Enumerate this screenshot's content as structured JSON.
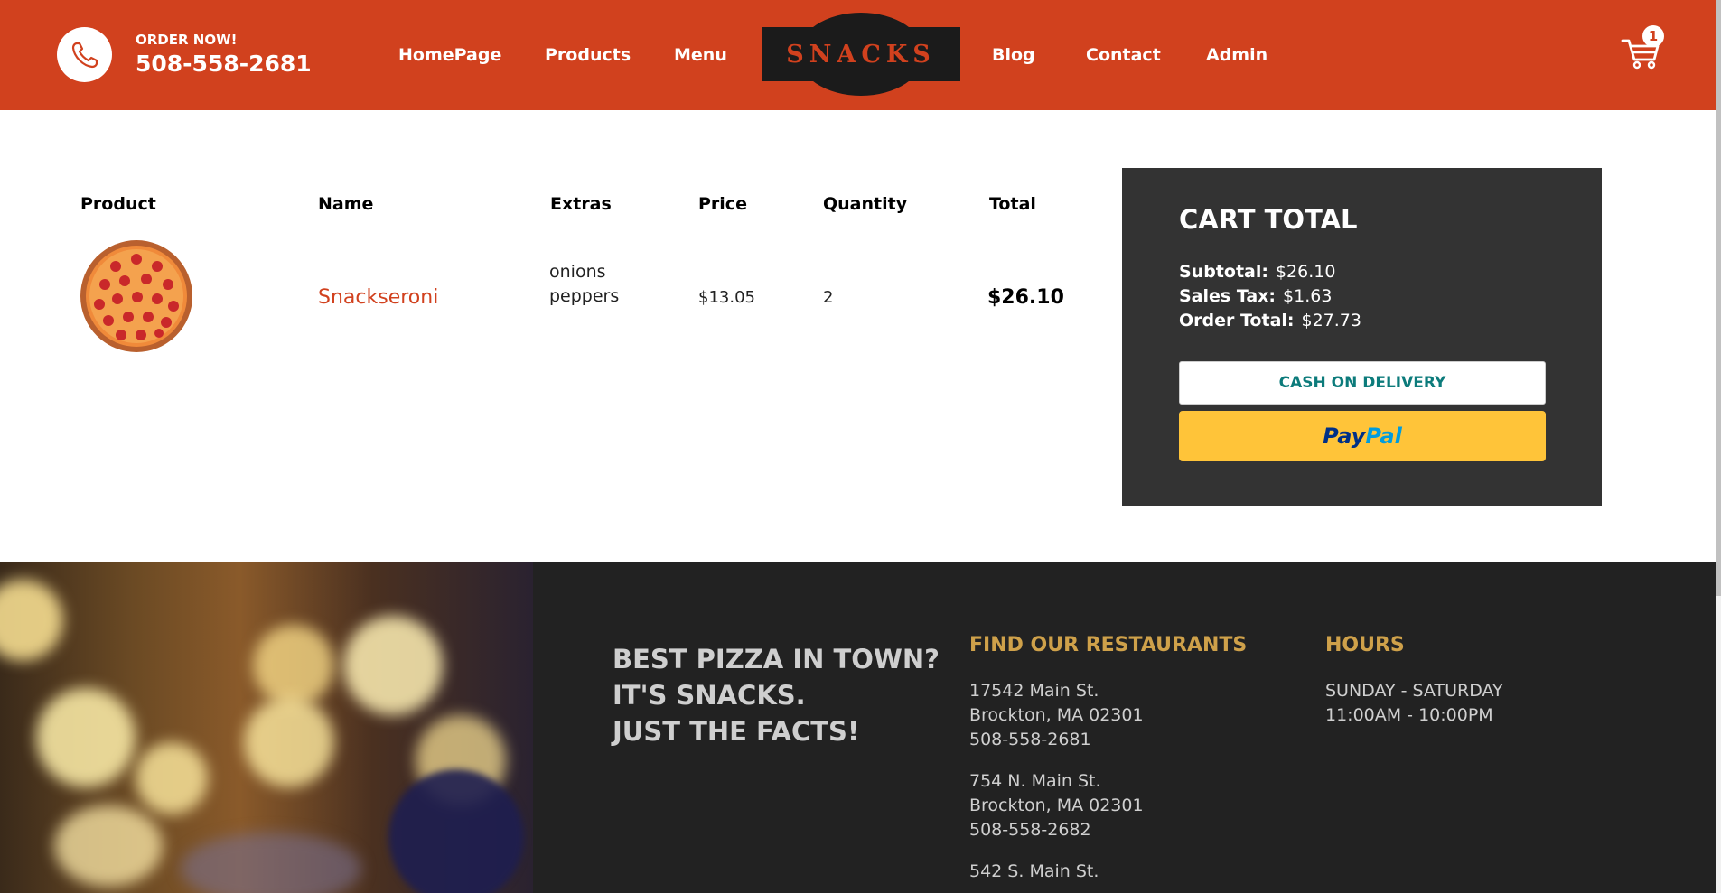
{
  "header": {
    "order_now": "ORDER NOW!",
    "phone": "508-558-2681",
    "nav": [
      "HomePage",
      "Products",
      "Menu",
      "Blog",
      "Contact",
      "Admin"
    ],
    "logo": "SNACKS",
    "cart_count": "1",
    "colors": {
      "brand": "#d1411e",
      "logo_bg": "#1b1b1b"
    }
  },
  "cart_table": {
    "headers": [
      "Product",
      "Name",
      "Extras",
      "Price",
      "Quantity",
      "Total"
    ],
    "rows": [
      {
        "image": "pepperoni-pizza-image",
        "name": "Snackseroni",
        "extras": [
          "onions",
          "peppers"
        ],
        "price": "$13.05",
        "quantity": "2",
        "total": "$26.10"
      }
    ]
  },
  "cart_total": {
    "title": "CART TOTAL",
    "subtotal_label": "Subtotal:",
    "subtotal": "$26.10",
    "tax_label": "Sales Tax:",
    "tax": "$1.63",
    "order_total_label": "Order Total:",
    "order_total": "$27.73",
    "cod_button": "CASH ON DELIVERY",
    "paypal_pay": "Pay",
    "paypal_pal": "Pal",
    "colors": {
      "box": "#333333",
      "paypal": "#ffc439"
    }
  },
  "footer": {
    "slogan": [
      "BEST PIZZA IN TOWN?",
      "IT'S SNACKS.",
      "JUST THE FACTS!"
    ],
    "restaurants_heading": "FIND OUR RESTAURANTS",
    "restaurants": [
      [
        "17542 Main St.",
        "Brockton, MA 02301",
        "508-558-2681"
      ],
      [
        "754 N. Main St.",
        "Brockton, MA 02301",
        "508-558-2682"
      ],
      [
        "542 S. Main St."
      ]
    ],
    "hours_heading": "HOURS",
    "hours": [
      "SUNDAY - SATURDAY",
      "11:00AM - 10:00PM"
    ],
    "colors": {
      "bg": "#222222",
      "heading": "#cfa14a"
    }
  }
}
